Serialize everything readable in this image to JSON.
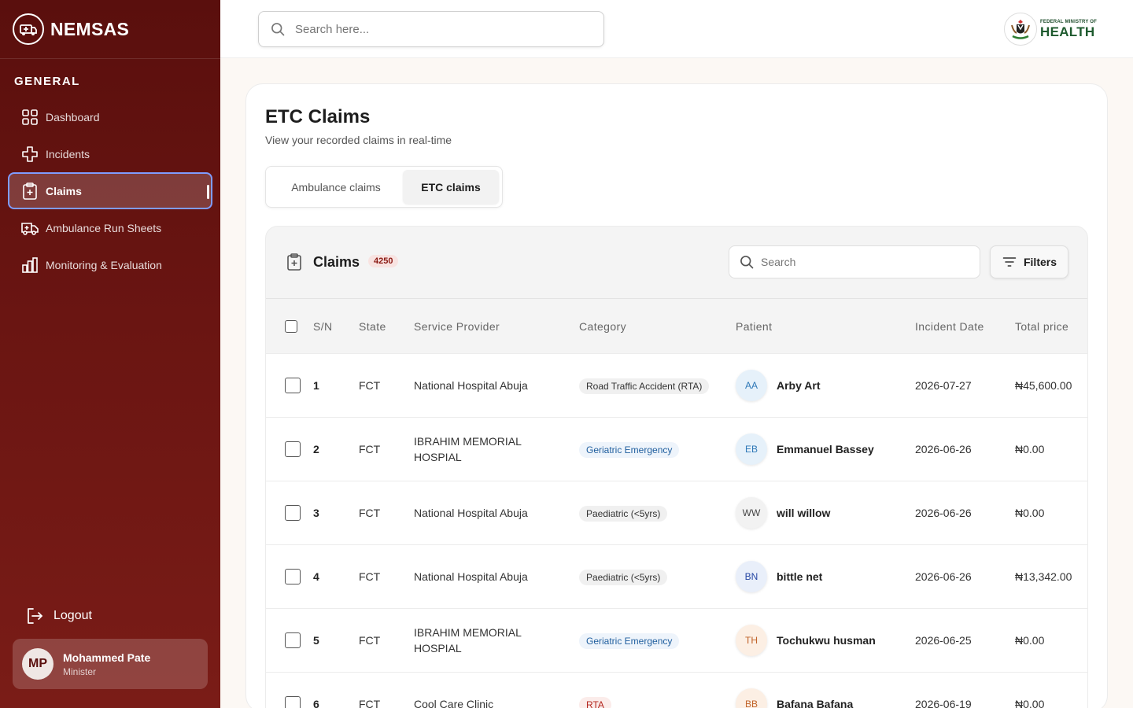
{
  "brand": {
    "name": "NEMSAS"
  },
  "sidebar": {
    "section": "GENERAL",
    "items": [
      {
        "label": "Dashboard",
        "icon": "grid-icon"
      },
      {
        "label": "Incidents",
        "icon": "medical-cross-icon"
      },
      {
        "label": "Claims",
        "icon": "clipboard-plus-icon",
        "active": true
      },
      {
        "label": "Ambulance Run Sheets",
        "icon": "ambulance-icon"
      },
      {
        "label": "Monitoring & Evaluation",
        "icon": "bar-chart-icon"
      }
    ],
    "logout": "Logout",
    "user": {
      "initials": "MP",
      "name": "Mohammed Pate",
      "role": "Minister"
    }
  },
  "topbar": {
    "search_placeholder": "Search here...",
    "ministry_small": "FEDERAL MINISTRY OF",
    "ministry_big": "HEALTH"
  },
  "page": {
    "title": "ETC Claims",
    "subtitle": "View your recorded claims in real-time",
    "tabs": [
      {
        "label": "Ambulance claims",
        "active": false
      },
      {
        "label": "ETC claims",
        "active": true
      }
    ]
  },
  "claims": {
    "title": "Claims",
    "count": "4250",
    "search_placeholder": "Search",
    "filters_label": "Filters",
    "columns": [
      "S/N",
      "State",
      "Service Provider",
      "Category",
      "Patient",
      "Incident Date",
      "Total price"
    ],
    "rows": [
      {
        "sn": "1",
        "state": "FCT",
        "provider": "National Hospital Abuja",
        "category": "Road Traffic Accident (RTA)",
        "cat_style": "grey",
        "initials": "AA",
        "av_style": "blue",
        "patient": "Arby Art",
        "date": "2026-07-27",
        "price": "₦45,600.00"
      },
      {
        "sn": "2",
        "state": "FCT",
        "provider": "IBRAHIM MEMORIAL HOSPIAL",
        "category": "Geriatric Emergency",
        "cat_style": "blue",
        "initials": "EB",
        "av_style": "blue",
        "patient": "Emmanuel Bassey",
        "date": "2026-06-26",
        "price": "₦0.00"
      },
      {
        "sn": "3",
        "state": "FCT",
        "provider": "National Hospital Abuja",
        "category": "Paediatric (<5yrs)",
        "cat_style": "grey",
        "initials": "WW",
        "av_style": "grey",
        "patient": "will willow",
        "date": "2026-06-26",
        "price": "₦0.00"
      },
      {
        "sn": "4",
        "state": "FCT",
        "provider": "National Hospital Abuja",
        "category": "Paediatric (<5yrs)",
        "cat_style": "grey",
        "initials": "BN",
        "av_style": "navy",
        "patient": "bittle net",
        "date": "2026-06-26",
        "price": "₦13,342.00"
      },
      {
        "sn": "5",
        "state": "FCT",
        "provider": "IBRAHIM MEMORIAL HOSPIAL",
        "category": "Geriatric Emergency",
        "cat_style": "blue",
        "initials": "TH",
        "av_style": "orange",
        "patient": "Tochukwu husman",
        "date": "2026-06-25",
        "price": "₦0.00"
      },
      {
        "sn": "6",
        "state": "FCT",
        "provider": "Cool Care Clinic",
        "category": "RTA",
        "cat_style": "red",
        "initials": "BB",
        "av_style": "orange",
        "patient": "Bafana Bafana",
        "date": "2026-06-19",
        "price": "₦0.00"
      }
    ]
  }
}
